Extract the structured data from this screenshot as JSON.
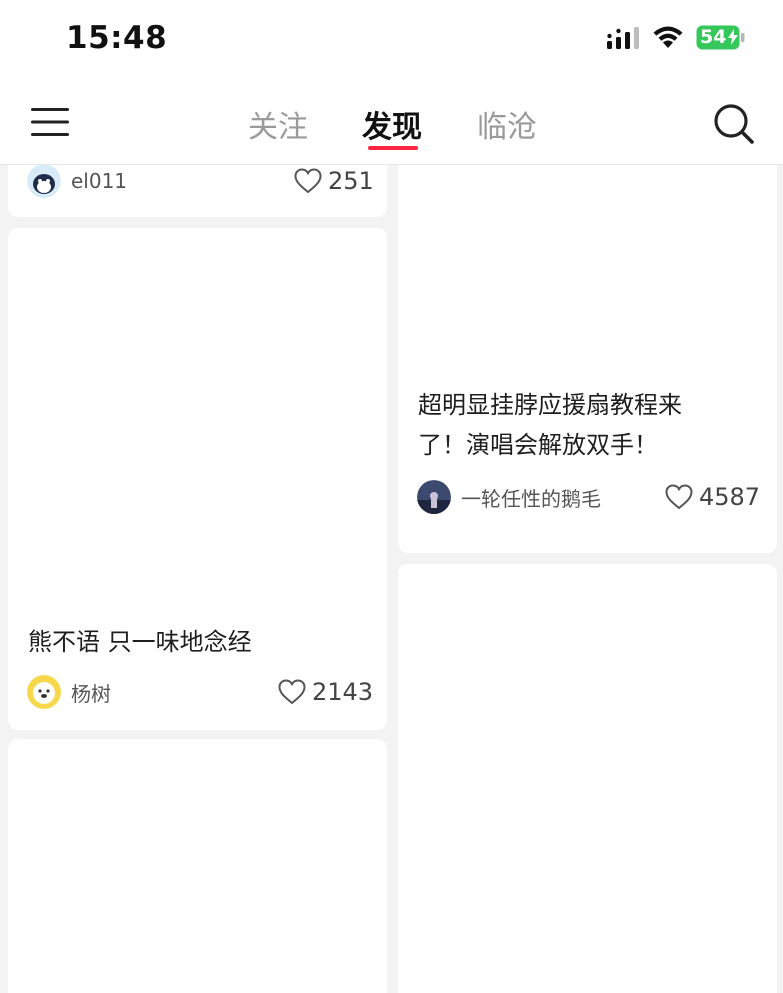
{
  "status_bar": {
    "time": "15:48",
    "battery": "54",
    "icons": [
      "cellular-signal-icon",
      "wifi-icon",
      "battery-charging-icon"
    ]
  },
  "nav": {
    "tabs": [
      {
        "label": "关注",
        "active": false
      },
      {
        "label": "发现",
        "active": true
      },
      {
        "label": "临沧",
        "active": false
      }
    ],
    "accent_color": "#ff2442",
    "icons": [
      "menu-icon",
      "search-icon"
    ]
  },
  "feed": {
    "cards": [
      {
        "title": "",
        "author": "el011",
        "likes": "251"
      },
      {
        "title": "熊不语 只一味地念经",
        "author": "杨树",
        "likes": "2143"
      },
      {
        "title": "",
        "author": "",
        "likes": ""
      },
      {
        "title_line1": "超明显挂脖应援扇教程来",
        "title_line2": "了！演唱会解放双手！",
        "author": "一轮任性的鹅毛",
        "likes": "4587"
      },
      {
        "title": "",
        "author": "",
        "likes": ""
      }
    ]
  }
}
